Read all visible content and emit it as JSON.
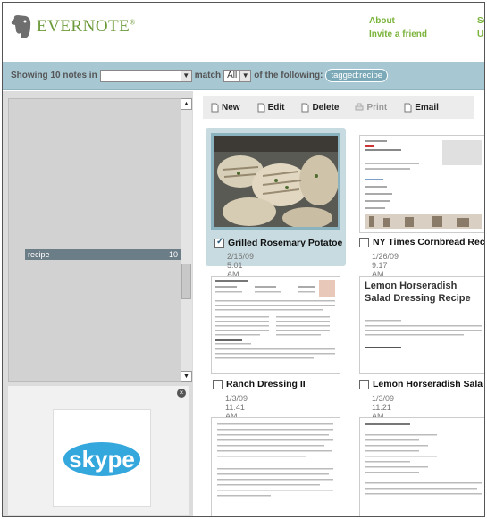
{
  "header": {
    "brand": "EVERNOTE",
    "brand_mark": "®",
    "links": [
      "About",
      "Invite a friend"
    ],
    "links_cut": [
      "Se",
      "Up"
    ]
  },
  "filter": {
    "prefix": "Showing 10 notes in",
    "notebook_value": "",
    "match_label": "match",
    "match_value": "All",
    "suffix": "of the following:",
    "tag_pill": "tagged:recipe"
  },
  "tags": {
    "items": [
      {
        "label": "recipe",
        "count": "10"
      }
    ]
  },
  "toolbar": {
    "new": "New",
    "edit": "Edit",
    "delete": "Delete",
    "print": "Print",
    "email": "Email"
  },
  "notes": [
    {
      "title": "Grilled Rosemary Potatoe",
      "date": "2/15/09 5:01 AM",
      "checked": true,
      "selected": true
    },
    {
      "title": "NY Times Cornbread Rec",
      "date": "1/26/09 9:17 AM",
      "checked": false,
      "selected": false
    },
    {
      "title": "Ranch Dressing II",
      "date": "1/3/09 11:41 AM",
      "checked": false,
      "selected": false
    },
    {
      "title": "Lemon Horseradish Sala",
      "date": "1/3/09 11:21 AM",
      "checked": false,
      "selected": false
    }
  ],
  "lemon_preview": {
    "heading": "Lemon Horseradish Salad Dressing Recipe"
  },
  "colors": {
    "brand_green": "#6c9a3a",
    "link_green": "#7ab33a",
    "filter_bar": "#a7c7d3",
    "selected_bg": "#c8dbe1",
    "tag_highlight": "#6b7d87"
  }
}
